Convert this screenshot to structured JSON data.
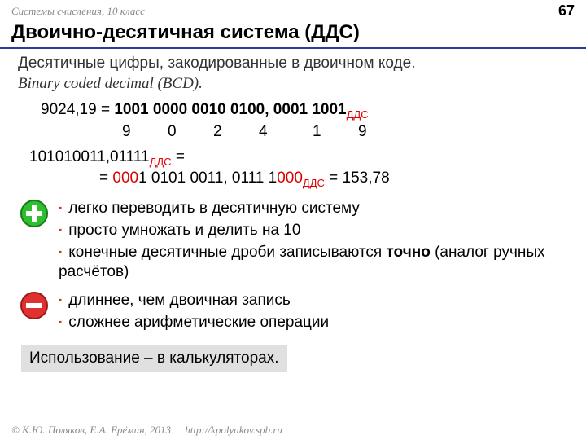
{
  "header": {
    "course": "Системы счисления, 10 класс",
    "page": "67"
  },
  "title": "Двоично-десятичная система (ДДС)",
  "intro": {
    "line1": "Десятичные цифры, закодированные в двоичном коде.",
    "line2": "Binary coded decimal (BCD)."
  },
  "example1": {
    "lhs": "9024,19 = ",
    "rhs": "1001 0000 0010 0100, 0001 1001",
    "sub": "ДДС",
    "digits": [
      "9",
      "0",
      "2",
      "4",
      "1",
      "9"
    ]
  },
  "example2": {
    "line1_a": "101010011,01111",
    "line1_sub": "ДДС",
    "line1_b": " =",
    "line2_a": "= ",
    "line2_pad": "000",
    "line2_b": "1 0101 0011, 0111 1",
    "line2_tail": "000",
    "line2_sub": "ДДС",
    "line2_c": " = 153,78"
  },
  "pros": [
    "легко переводить в десятичную систему",
    "просто умножать и делить на 10",
    "конечные десятичные дроби записываются точно (аналог ручных расчётов)"
  ],
  "pros_bold_word": "точно",
  "cons": [
    "длиннее, чем двоичная запись",
    "сложнее арифметические операции"
  ],
  "usage": "Использование – в калькуляторах.",
  "footer": {
    "copyright": "© К.Ю. Поляков, Е.А. Ерёмин, 2013",
    "url": "http://kpolyakov.spb.ru"
  }
}
